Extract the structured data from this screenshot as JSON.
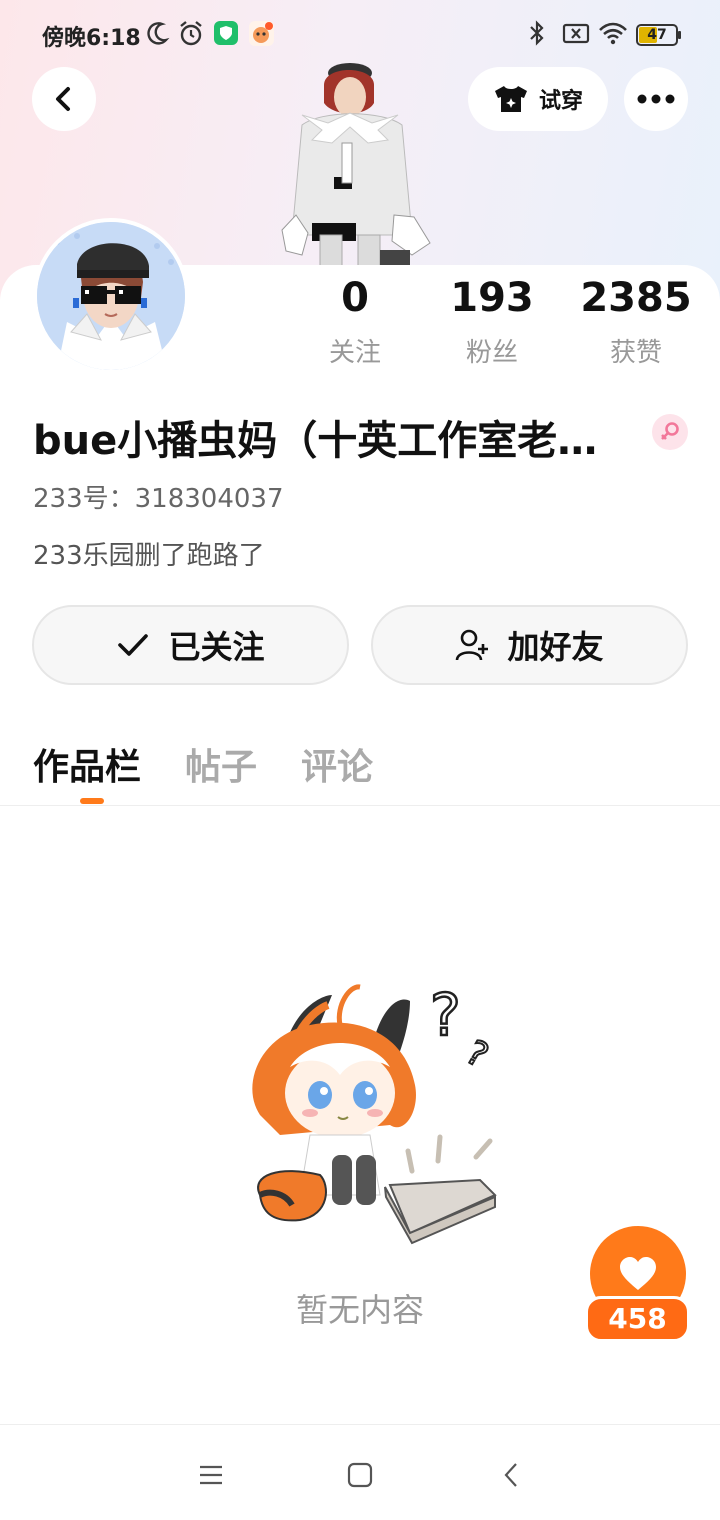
{
  "status_bar": {
    "time": "傍晚6:18",
    "battery": "47"
  },
  "header": {
    "try_on_label": "试穿"
  },
  "profile": {
    "stats": [
      {
        "value": "0",
        "label": "关注"
      },
      {
        "value": "193",
        "label": "粉丝"
      },
      {
        "value": "2385",
        "label": "获赞"
      }
    ],
    "username": "bue小播虫妈（十英工作室老…",
    "user_id": "233号：318304037",
    "bio": "233乐园删了跑路了"
  },
  "actions": {
    "followed_label": "已关注",
    "add_friend_label": "加好友"
  },
  "tabs": [
    "作品栏",
    "帖子",
    "评论"
  ],
  "active_tab": "作品栏",
  "empty_state": {
    "text": "暂无内容"
  },
  "like_widget": {
    "count": "458"
  },
  "colors": {
    "accent": "#ff7a1a",
    "female_badge": "#f2789a"
  }
}
